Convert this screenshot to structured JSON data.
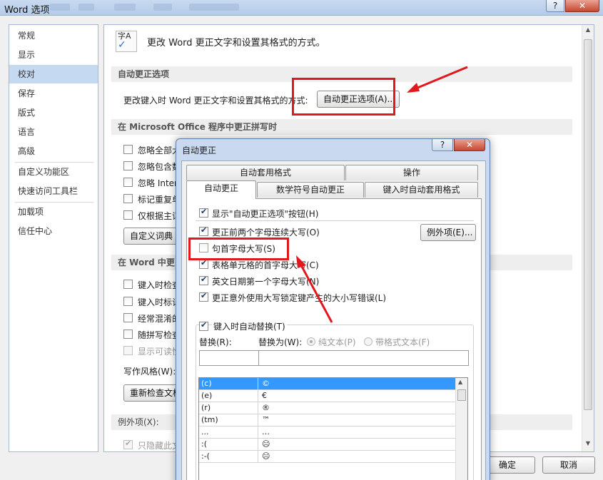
{
  "window": {
    "title": "Word 选项",
    "help_label": "?",
    "close_label": "✕"
  },
  "nav": {
    "items": [
      "常规",
      "显示",
      "校对",
      "保存",
      "版式",
      "语言",
      "高级",
      "自定义功能区",
      "快速访问工具栏",
      "加载项",
      "信任中心"
    ],
    "active": "校对"
  },
  "content": {
    "heading": "更改 Word 更正文字和设置其格式的方式。",
    "icon_text": "字A",
    "autocorrect_section": "自动更正选项",
    "autocorrect_desc": "更改键入时 Word 更正文字和设置其格式的方式:",
    "autocorrect_button": "自动更正选项(A)...",
    "office_section": "在 Microsoft Office 程序中更正拼写时",
    "office_options": [
      {
        "label": "忽略全部大",
        "checked": false
      },
      {
        "label": "忽略包含数",
        "checked": false
      },
      {
        "label": "忽略 Inter",
        "checked": false
      },
      {
        "label": "标记重复单",
        "checked": false
      },
      {
        "label": "仅根据主词",
        "checked": false
      }
    ],
    "custom_dict_button": "自定义词典",
    "word_section": "在 Word 中更",
    "word_options": [
      {
        "label": "键入时检查",
        "checked": false,
        "disabled": false
      },
      {
        "label": "键入时标记",
        "checked": false,
        "disabled": false
      },
      {
        "label": "经常混淆的",
        "checked": false,
        "disabled": false
      },
      {
        "label": "随拼写检查",
        "checked": false,
        "disabled": false
      },
      {
        "label": "显示可读性",
        "checked": false,
        "disabled": true
      }
    ],
    "writing_style_label": "写作风格(W):",
    "recheck_button": "重新检查文档",
    "exceptions_label": "例外项(X):",
    "hide_errors_label": "只隐藏此文",
    "ok_button": "确定",
    "cancel_button": "取消"
  },
  "dialog": {
    "title": "自动更正",
    "help_label": "?",
    "close_label": "✕",
    "tabs_back": [
      "自动套用格式",
      "操作"
    ],
    "tabs_front": [
      "自动更正",
      "数学符号自动更正",
      "键入时自动套用格式"
    ],
    "active_tab": "自动更正",
    "show_button_option": "显示\"自动更正选项\"按钮(H)",
    "options": [
      {
        "label": "更正前两个字母连续大写(O)",
        "checked": true
      },
      {
        "label": "句首字母大写(S)",
        "checked": false
      },
      {
        "label": "表格单元格的首字母大写(C)",
        "checked": true
      },
      {
        "label": "英文日期第一个字母大写(N)",
        "checked": true
      },
      {
        "label": "更正意外使用大写锁定键产生的大小写错误(L)",
        "checked": true
      }
    ],
    "exceptions_button": "例外项(E)...",
    "replace_group_label": "键入时自动替换(T)",
    "replace_label": "替换(R):",
    "with_label": "替换为(W):",
    "plain_text": "纯文本(P)",
    "formatted_text": "带格式文本(F)",
    "replacements": [
      {
        "from": "(c)",
        "to": "©"
      },
      {
        "from": "(e)",
        "to": "€"
      },
      {
        "from": "(r)",
        "to": "®"
      },
      {
        "from": "(tm)",
        "to": "™"
      },
      {
        "from": "...",
        "to": "…"
      },
      {
        "from": ":(",
        "to": "☹"
      },
      {
        "from": ":-(",
        "to": "☹"
      }
    ]
  }
}
